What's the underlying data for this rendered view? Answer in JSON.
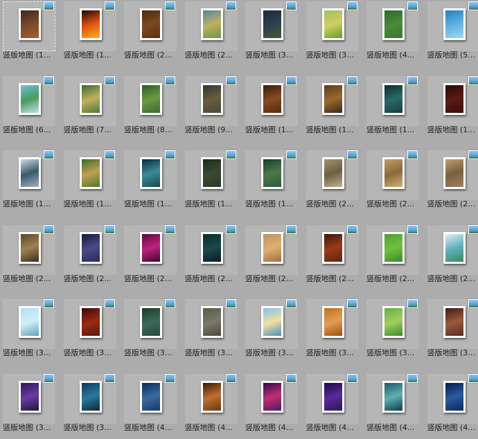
{
  "items": [
    {
      "label": "竖版地图 (1...",
      "colors": [
        "#3a2a1a",
        "#7a4a2a",
        "#a06030"
      ],
      "icon": "picture-icon",
      "selected": true
    },
    {
      "label": "竖版地图 (1...",
      "colors": [
        "#1a0a00",
        "#e05010",
        "#ffb020"
      ],
      "icon": "picture-icon"
    },
    {
      "label": "竖版地图 (2...",
      "colors": [
        "#4a2a10",
        "#7a4a20",
        "#5a3010"
      ],
      "icon": "picture-icon"
    },
    {
      "label": "竖版地图 (2...",
      "colors": [
        "#4a8aa0",
        "#c0b060",
        "#6a9a40"
      ],
      "icon": "picture-icon"
    },
    {
      "label": "竖版地图 (3...",
      "colors": [
        "#1a2a3a",
        "#2a4050",
        "#4a5a30"
      ],
      "icon": "picture-icon"
    },
    {
      "label": "竖版地图 (3...",
      "colors": [
        "#a0c060",
        "#d0d060",
        "#6a9a30"
      ],
      "icon": "picture-icon"
    },
    {
      "label": "竖版地图 (4...",
      "colors": [
        "#2a6a2a",
        "#4a8a3a",
        "#3a7a30"
      ],
      "icon": "picture-icon"
    },
    {
      "label": "竖版地图 (5...",
      "colors": [
        "#2080c0",
        "#60b0e0",
        "#a0d8f0"
      ],
      "icon": "picture-icon"
    },
    {
      "label": "竖版地图 (6...",
      "colors": [
        "#70c0e0",
        "#4a9a5a",
        "#c0e0f0"
      ],
      "icon": "picture-icon"
    },
    {
      "label": "竖版地图 (7...",
      "colors": [
        "#3a6a2a",
        "#c0b060",
        "#4a7a30"
      ],
      "icon": "picture-icon"
    },
    {
      "label": "竖版地图 (8...",
      "colors": [
        "#2a5a2a",
        "#6a9a40",
        "#3a6a30"
      ],
      "icon": "picture-icon"
    },
    {
      "label": "竖版地图 (9...",
      "colors": [
        "#2a3a2a",
        "#6a5a40",
        "#4a4a3a"
      ],
      "icon": "picture-icon"
    },
    {
      "label": "竖版地图 (1...",
      "colors": [
        "#3a1a0a",
        "#8a4a20",
        "#5a2a10"
      ],
      "icon": "picture-icon"
    },
    {
      "label": "竖版地图 (1...",
      "colors": [
        "#5a3a1a",
        "#9a6a30",
        "#3a2a1a"
      ],
      "icon": "picture-icon"
    },
    {
      "label": "竖版地图 (1...",
      "colors": [
        "#0a2a2a",
        "#2a6a6a",
        "#1a3a3a"
      ],
      "icon": "picture-icon"
    },
    {
      "label": "竖版地图 (1...",
      "colors": [
        "#2a0a0a",
        "#5a1a10",
        "#3a1010"
      ],
      "icon": "picture-icon"
    },
    {
      "label": "竖版地图 (1...",
      "colors": [
        "#d0d8e0",
        "#3a5a6a",
        "#a0b0c0"
      ],
      "icon": "picture-icon"
    },
    {
      "label": "竖版地图 (1...",
      "colors": [
        "#3a6a2a",
        "#c0a050",
        "#4a7a30"
      ],
      "icon": "picture-icon"
    },
    {
      "label": "竖版地图 (1...",
      "colors": [
        "#0a2a3a",
        "#3a8a9a",
        "#1a4a4a"
      ],
      "icon": "picture-icon"
    },
    {
      "label": "竖版地图 (1...",
      "colors": [
        "#1a2a1a",
        "#3a4a30",
        "#2a3a2a"
      ],
      "icon": "picture-icon"
    },
    {
      "label": "竖版地图 (1...",
      "colors": [
        "#1a3a2a",
        "#4a7a4a",
        "#2a5a3a"
      ],
      "icon": "picture-icon"
    },
    {
      "label": "竖版地图 (2...",
      "colors": [
        "#a09070",
        "#6a6040",
        "#c0b090"
      ],
      "icon": "picture-icon"
    },
    {
      "label": "竖版地图 (2...",
      "colors": [
        "#c0a060",
        "#8a6a3a",
        "#d0b070"
      ],
      "icon": "picture-icon"
    },
    {
      "label": "竖版地图 (2...",
      "colors": [
        "#c0a070",
        "#7a6040",
        "#a08060"
      ],
      "icon": "picture-icon"
    },
    {
      "label": "竖版地图 (2...",
      "colors": [
        "#5a4a2a",
        "#a08050",
        "#3a3020"
      ],
      "icon": "picture-icon"
    },
    {
      "label": "竖版地图 (2...",
      "colors": [
        "#1a1a3a",
        "#4a4a8a",
        "#2a2a5a"
      ],
      "icon": "picture-icon"
    },
    {
      "label": "竖版地图 (2...",
      "colors": [
        "#5a0a3a",
        "#c02080",
        "#3a0a2a"
      ],
      "icon": "picture-icon"
    },
    {
      "label": "竖版地图 (2...",
      "colors": [
        "#0a2a2a",
        "#1a4a4a",
        "#0a1a2a"
      ],
      "icon": "picture-icon"
    },
    {
      "label": "竖版地图 (2...",
      "colors": [
        "#c09060",
        "#e0b070",
        "#a07040"
      ],
      "icon": "picture-icon"
    },
    {
      "label": "竖版地图 (2...",
      "colors": [
        "#3a1a0a",
        "#9a3a1a",
        "#5a2a10"
      ],
      "icon": "picture-icon"
    },
    {
      "label": "竖版地图 (2...",
      "colors": [
        "#4aa030",
        "#70c040",
        "#3a8a2a"
      ],
      "icon": "picture-icon"
    },
    {
      "label": "竖版地图 (2...",
      "colors": [
        "#e0f0f0",
        "#60b0c0",
        "#3a8a5a"
      ],
      "icon": "picture-icon"
    },
    {
      "label": "竖版地图 (3...",
      "colors": [
        "#b0e0f0",
        "#d0f0f8",
        "#60a0c0"
      ],
      "icon": "picture-icon"
    },
    {
      "label": "竖版地图 (3...",
      "colors": [
        "#3a0a0a",
        "#9a2a10",
        "#5a1a10"
      ],
      "icon": "picture-icon"
    },
    {
      "label": "竖版地图 (3...",
      "colors": [
        "#1a3a2a",
        "#3a6a5a",
        "#2a4a3a"
      ],
      "icon": "picture-icon"
    },
    {
      "label": "竖版地图 (3...",
      "colors": [
        "#5a5a4a",
        "#7a7a6a",
        "#4a4a40"
      ],
      "icon": "picture-icon"
    },
    {
      "label": "竖版地图 (3...",
      "colors": [
        "#80c0f0",
        "#f0e0a0",
        "#4a90c0"
      ],
      "icon": "picture-icon"
    },
    {
      "label": "竖版地图 (3...",
      "colors": [
        "#c07020",
        "#e0a050",
        "#a05010"
      ],
      "icon": "picture-icon"
    },
    {
      "label": "竖版地图 (3...",
      "colors": [
        "#60b040",
        "#a0d060",
        "#3a8a2a"
      ],
      "icon": "picture-icon"
    },
    {
      "label": "竖版地图 (3...",
      "colors": [
        "#3a1a1a",
        "#9a5a3a",
        "#5a2a20"
      ],
      "icon": "picture-icon"
    },
    {
      "label": "竖版地图 (3...",
      "colors": [
        "#2a1a5a",
        "#6a3aa0",
        "#1a1a3a"
      ],
      "icon": "picture-icon"
    },
    {
      "label": "竖版地图 (3...",
      "colors": [
        "#0a3a5a",
        "#2a7a9a",
        "#0a2a3a"
      ],
      "icon": "picture-icon"
    },
    {
      "label": "竖版地图 (4...",
      "colors": [
        "#0a2a5a",
        "#3a6aa0",
        "#1a3a6a"
      ],
      "icon": "picture-icon"
    },
    {
      "label": "竖版地图 (4...",
      "colors": [
        "#3a1a0a",
        "#c07030",
        "#6a3a10"
      ],
      "icon": "picture-icon"
    },
    {
      "label": "竖版地图 (4...",
      "colors": [
        "#2a0a4a",
        "#c03070",
        "#4a1a6a"
      ],
      "icon": "picture-icon"
    },
    {
      "label": "竖版地图 (4...",
      "colors": [
        "#1a0a4a",
        "#5a2a9a",
        "#2a1a5a"
      ],
      "icon": "picture-icon"
    },
    {
      "label": "竖版地图 (4...",
      "colors": [
        "#1a5a6a",
        "#60b0b0",
        "#0a3a4a"
      ],
      "icon": "picture-icon"
    },
    {
      "label": "竖版地图 (4...",
      "colors": [
        "#0a1a4a",
        "#2a5aa0",
        "#0a2a5a"
      ],
      "icon": "picture-icon"
    }
  ]
}
